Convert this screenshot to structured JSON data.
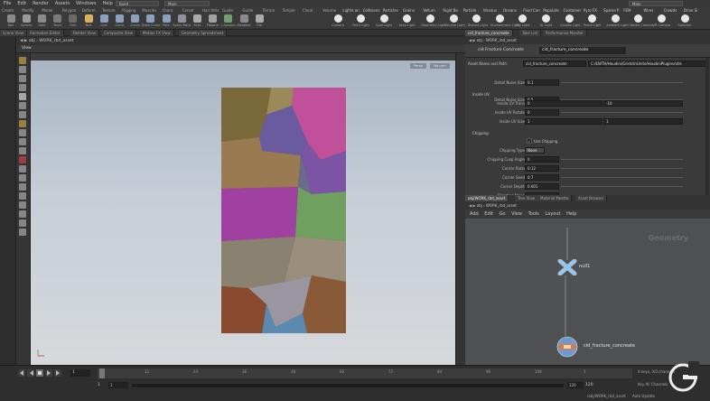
{
  "menu": {
    "items": [
      "File",
      "Edit",
      "Render",
      "Assets",
      "Windows",
      "Help"
    ],
    "desktop": "Build",
    "desktop2": "Main",
    "right": "Main"
  },
  "shelf": {
    "tabs": [
      "Create",
      "Modify",
      "Model",
      "Polygon",
      "Deform",
      "Texture",
      "Rigging",
      "Muscles",
      "Chara",
      "Constr",
      "Hair Utils",
      "Guide",
      "Guide",
      "Terrain",
      "Simple",
      "Cloud",
      "Volume",
      "Lights an",
      "Collisions",
      "Particles",
      "Grains",
      "Vellum",
      "Rigid Bo",
      "Particle",
      "Viscous",
      "Oceans",
      "Fluid Con",
      "Populate",
      "Container",
      "Pyro FX",
      "Sparse P",
      "FEM",
      "Wires",
      "Crowds",
      "Drive Si"
    ],
    "tools": [
      "Box",
      "Sphere",
      "Tube",
      "Torus",
      "Grid",
      "Null",
      "Line",
      "Circle",
      "Curve",
      "Draw Curve",
      "Path",
      "Spray Paint",
      "Font",
      "Platonic",
      "L-System",
      "Metaball",
      "File",
      "Camera",
      "Point Light",
      "Spot Light",
      "Area Light",
      "Geometry Light",
      "Volume Light",
      "Distant Light",
      "Environment Light",
      "Sky Light",
      "GI Light",
      "Caustic Light",
      "Portal Light",
      "Ambient Light",
      "Stereo Camera",
      "VR Camera",
      "Switcher"
    ]
  },
  "pane_tabs": [
    "Scene View",
    "Animation Editor",
    "Render View",
    "Composite View",
    "Motion FX View",
    "Geometry Spreadsheet"
  ],
  "viewport": {
    "path": "obj",
    "node": "WORK_rbd_asset",
    "title": "View",
    "persp": "Persp",
    "cam": "No cam"
  },
  "params": {
    "tabs": [
      "cid_fracture_concreate",
      "Take List",
      "Performance Monitor"
    ],
    "path_obj": "obj",
    "path_node": "WORK_rbd_asset",
    "node_type": "cid Fracture Concreate",
    "node_name": "cid_fracture_concreate",
    "asset_label": "Asset Name and Path",
    "asset_name": "cid_fracture_concreate",
    "asset_path": "C:/EWTH/Houdini/Grids/InUnits/HoudiniPlugins/otls",
    "rows": [
      {
        "label": "Detail Noise Size",
        "value": "0.5"
      },
      {
        "label": "Detail Noise Size",
        "value": "0.1"
      }
    ],
    "section1": "Inside UV",
    "uv_trans_label": "Inside UV Trans",
    "uv_trans": "0",
    "uv_trans2": "-10",
    "uv_rot_label": "Inside UV Rotate",
    "uv_rot": "0",
    "uv_size_label": "Inside UV Size",
    "uv_size": "1",
    "uv_size2": "1",
    "section2": "Chipping",
    "use_chipping": "Use Chipping",
    "chip_type_label": "Chipping Type",
    "chip_type": "None",
    "chip_rows": [
      {
        "label": "Chipping Cusp Angle",
        "value": "0"
      },
      {
        "label": "Corner Ratio",
        "value": "0.12"
      },
      {
        "label": "Corner Seed",
        "value": "0.7"
      },
      {
        "label": "Corner Depth",
        "value": "0.001"
      },
      {
        "label": "Direction Noise",
        "value": ""
      }
    ]
  },
  "network": {
    "tabs": [
      "obj/WORK_rbd_asset",
      "Tree View",
      "Material Palette",
      "Asset Browser"
    ],
    "path_obj": "obj",
    "path_node": "WORK_rbd_asset",
    "menu": [
      "Add",
      "Edit",
      "Go",
      "View",
      "Tools",
      "Layout",
      "Help"
    ],
    "context": "Geometry",
    "null_node": "null1",
    "frac_node": "cid_fracture_concreate"
  },
  "timeline": {
    "frame": "1",
    "start": "1",
    "start2": "1",
    "end": "120",
    "end2": "120",
    "ticks": [
      "12",
      "24",
      "36",
      "48",
      "60",
      "72",
      "84",
      "96",
      "108",
      "1"
    ],
    "keys": "0 keys, 0/0 channels",
    "auto": "Key All Channels",
    "path": "/obj/WORK_rbd_asset",
    "mode": "Auto Update"
  },
  "watermark": "G"
}
